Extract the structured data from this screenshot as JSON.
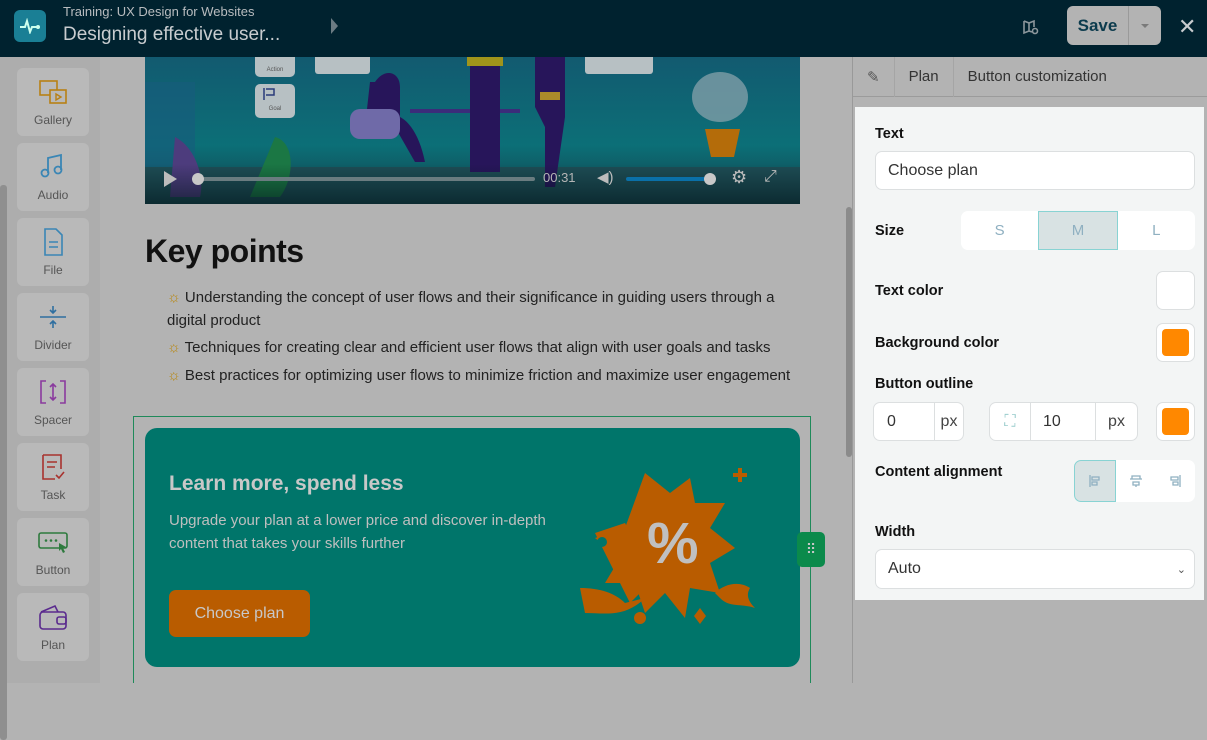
{
  "header": {
    "course": "Training: UX Design for Websites",
    "title": "Designing effective user...",
    "save_label": "Save"
  },
  "sidebar": {
    "items": [
      {
        "label": "Gallery"
      },
      {
        "label": "Audio"
      },
      {
        "label": "File"
      },
      {
        "label": "Divider"
      },
      {
        "label": "Spacer"
      },
      {
        "label": "Task"
      },
      {
        "label": "Button"
      },
      {
        "label": "Plan"
      }
    ]
  },
  "video": {
    "time": "00:31",
    "progress": 0.0,
    "volume": 1.0,
    "overlay_labels": [
      "Action",
      "Goal"
    ]
  },
  "content": {
    "heading": "Key points",
    "bullets": [
      "Understanding the concept of user flows and their significance in guiding users through a digital product",
      "Techniques for creating clear and efficient user flows that align with user goals and tasks",
      "Best practices for optimizing user flows to minimize friction and maximize user engagement"
    ],
    "card": {
      "title": "Learn more, spend less",
      "description": "Upgrade your plan at a lower price and discover in-depth content that takes your skills further",
      "button": "Choose plan"
    }
  },
  "panel": {
    "breadcrumb": [
      "Plan",
      "Button customization"
    ],
    "text_label": "Text",
    "text_value": "Choose plan",
    "size_label": "Size",
    "sizes": [
      "S",
      "M",
      "L"
    ],
    "size_selected": "M",
    "text_color_label": "Text color",
    "text_color": "#ffffff",
    "bg_color_label": "Background color",
    "bg_color": "#ff8800",
    "outline_label": "Button outline",
    "outline_width": "0",
    "outline_radius": "10",
    "unit": "px",
    "outline_color": "#ff8800",
    "alignment_label": "Content alignment",
    "alignment_selected": "left",
    "width_label": "Width",
    "width_value": "Auto"
  }
}
